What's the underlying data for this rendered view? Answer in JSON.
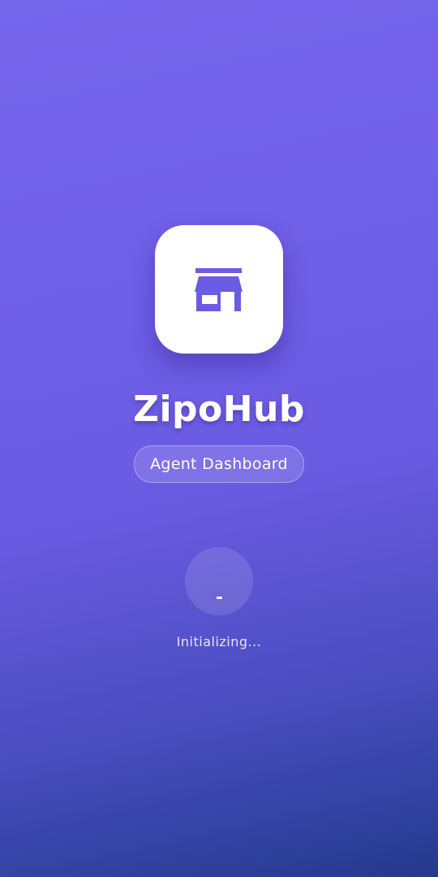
{
  "app": {
    "name": "ZipoHub",
    "subtitle": "Agent Dashboard",
    "logo_icon": "store-icon"
  },
  "loader": {
    "status_text": "Initializing...",
    "indicator": "-"
  },
  "colors": {
    "gradient_top": "#7766ec",
    "gradient_mid": "#6b5ae2",
    "gradient_bottom": "#233a8d",
    "icon_accent": "#6c5be3",
    "tile_background": "#ffffff"
  }
}
